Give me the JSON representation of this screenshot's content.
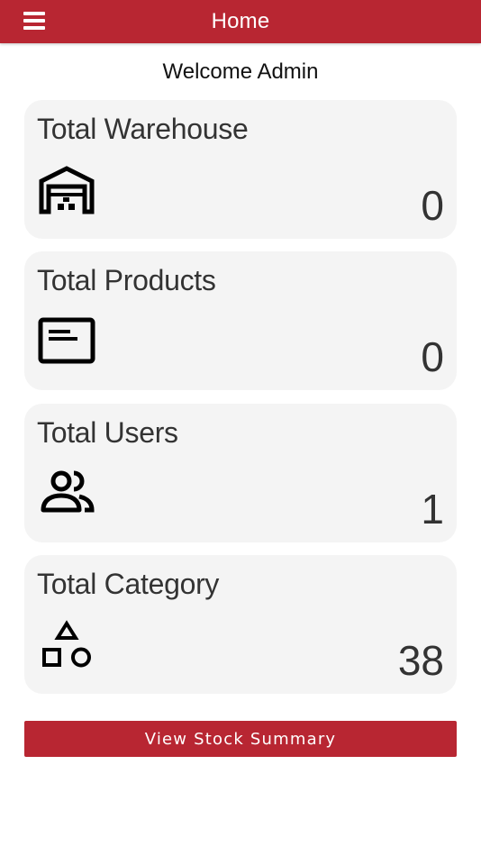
{
  "header": {
    "title": "Home",
    "menu_icon": "hamburger-menu-icon",
    "background": "#b82632"
  },
  "welcome": "Welcome Admin",
  "cards": [
    {
      "title": "Total Warehouse",
      "icon": "warehouse-icon",
      "value": "0"
    },
    {
      "title": "Total Products",
      "icon": "product-card-icon",
      "value": "0"
    },
    {
      "title": "Total Users",
      "icon": "users-group-icon",
      "value": "1"
    },
    {
      "title": "Total Category",
      "icon": "category-shapes-icon",
      "value": "38"
    }
  ],
  "actions": {
    "stock_summary_label": "View Stock Summary"
  },
  "colors": {
    "accent": "#b82632",
    "card_bg": "#f4f4f4",
    "text": "#333333"
  }
}
